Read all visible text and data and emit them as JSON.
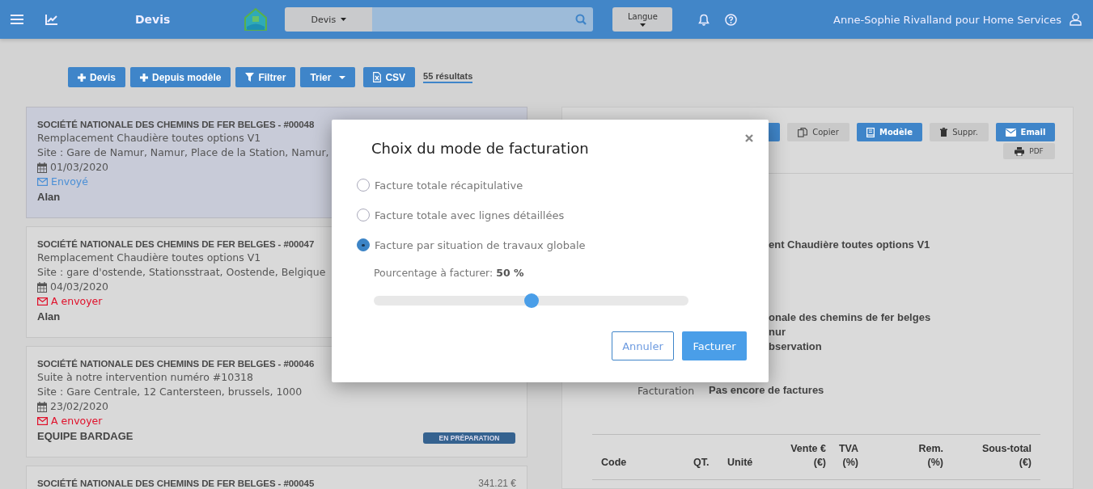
{
  "topbar": {
    "page_title": "Devis",
    "search": {
      "scope": "Devis"
    },
    "language_button": "Langue",
    "user": "Anne-Sophie Rivalland pour Home Services"
  },
  "toolbar": {
    "buttons": [
      {
        "label": "Devis"
      },
      {
        "label": "Depuis modèle"
      },
      {
        "label": "Filtrer"
      },
      {
        "label": "Trier"
      },
      {
        "label": "CSV"
      }
    ],
    "result_count": "55 résultats"
  },
  "quotes": [
    {
      "selected": true,
      "title": "SOCIÉTÉ NATIONALE DES CHEMINS DE FER BELGES - #00048",
      "description": "Remplacement Chaudière toutes options V1",
      "site": "Site : Gare de Namur, Namur, Place de la Station, Namur,",
      "date": "01/03/2020",
      "status": {
        "kind": "sent",
        "label": "Envoyé"
      },
      "assignee": "Alan"
    },
    {
      "selected": false,
      "title": "SOCIÉTÉ NATIONALE DES CHEMINS DE FER BELGES - #00047",
      "description": "Remplacement Chaudière toutes options V1",
      "site": "Site : gare d'ostende, Stationsstraat, Oostende, Belgique",
      "date": "04/03/2020",
      "status": {
        "kind": "pending",
        "label": "A envoyer"
      },
      "assignee": "Alan"
    },
    {
      "selected": false,
      "title": "SOCIÉTÉ NATIONALE DES CHEMINS DE FER BELGES - #00046",
      "description": "Suite à notre intervention numéro #10318",
      "site": "Site : Gare Centrale, 12 Cantersteen, brussels, 1000",
      "date": "23/02/2020",
      "status": {
        "kind": "pending",
        "label": "A envoyer"
      },
      "assignee": "EQUIPE BARDAGE",
      "badge": "EN PRÉPARATION"
    },
    {
      "selected": false,
      "title": "SOCIÉTÉ NATIONALE DES CHEMINS DE FER BELGES - #00045",
      "amount": "341.21 €"
    }
  ],
  "detail": {
    "actions": [
      {
        "label": "Copier",
        "kind": "secondary"
      },
      {
        "label": "Modèle",
        "kind": "primary"
      },
      {
        "label": "Suppr.",
        "kind": "secondary"
      },
      {
        "label": "Email",
        "kind": "primary"
      },
      {
        "label": "PDF",
        "kind": "secondary"
      }
    ],
    "rows": [
      {
        "value": "ent Chaudière toutes options V1"
      },
      {
        "value": "onale des chemins de fer belges"
      },
      {
        "value": "nur"
      },
      {
        "value": "bservation"
      },
      {
        "label": "Facturation",
        "value": "Pas encore de factures"
      }
    ],
    "table": {
      "columns": [
        {
          "lines": [
            "Code"
          ]
        },
        {
          "lines": [
            "QT."
          ]
        },
        {
          "lines": [
            "Unité"
          ]
        },
        {
          "lines": [
            "Vente €",
            "(€)"
          ]
        },
        {
          "lines": [
            "TVA",
            "(%)"
          ]
        },
        {
          "lines": [
            "Rem.",
            "(%)"
          ]
        },
        {
          "lines": [
            "Sous-total",
            "(€)"
          ]
        }
      ]
    }
  },
  "modal": {
    "title": "Choix du mode de facturation",
    "options": [
      {
        "label": "Facture totale récapitulative",
        "selected": false
      },
      {
        "label": "Facture totale avec lignes détaillées",
        "selected": false
      },
      {
        "label": "Facture par situation de travaux globale",
        "selected": true
      }
    ],
    "percentage": {
      "label": "Pourcentage à facturer: **50 %**",
      "level": 0.5
    },
    "buttons": [
      {
        "label": "Annuler",
        "kind": "secondary"
      },
      {
        "label": "Facturer",
        "kind": "primary"
      }
    ]
  }
}
